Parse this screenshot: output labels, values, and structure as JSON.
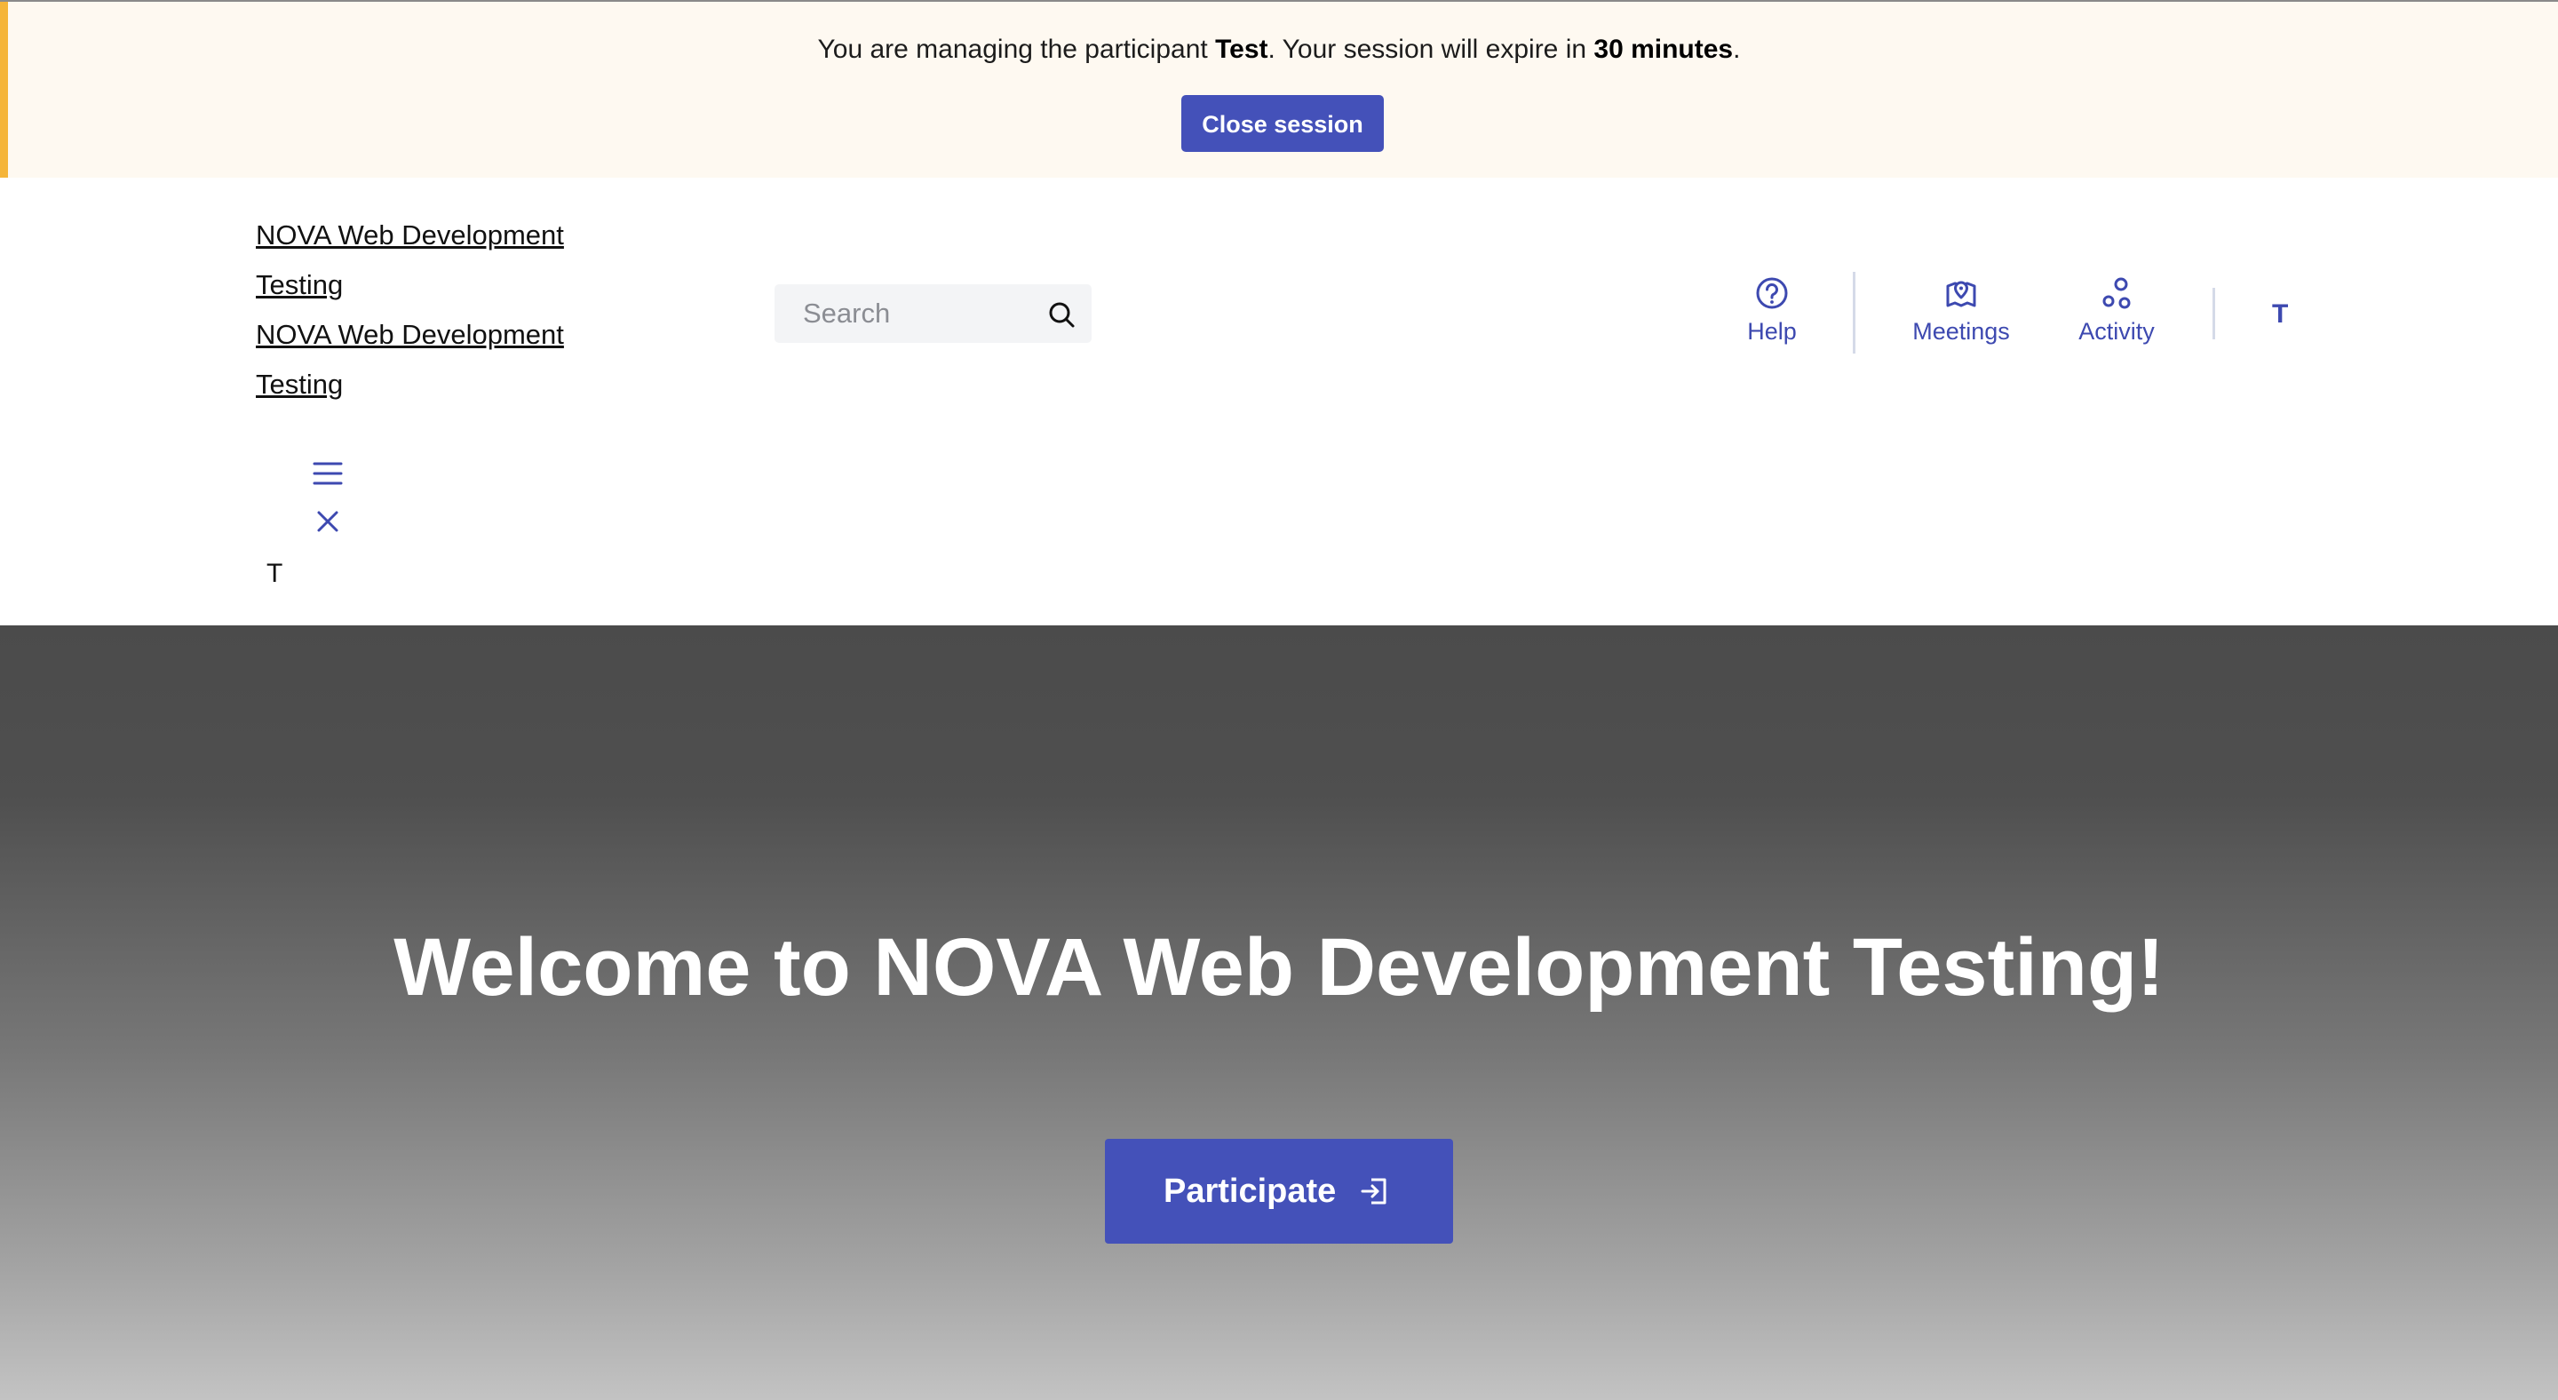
{
  "banner": {
    "text_prefix": "You are managing the participant ",
    "participant": "Test",
    "text_middle": ". Your session will expire in ",
    "duration": "30 minutes",
    "text_suffix": ".",
    "close_button_label": "Close session",
    "accent_color": "#f5b539",
    "background_color": "#fef9f1"
  },
  "header": {
    "org_links": [
      "NOVA Web Development",
      "Testing",
      "NOVA Web Development",
      "Testing"
    ],
    "search": {
      "placeholder": "Search",
      "icon": "search-icon"
    },
    "nav": [
      {
        "label": "Help",
        "icon": "help-icon"
      },
      {
        "label": "Meetings",
        "icon": "meetings-icon"
      },
      {
        "label": "Activity",
        "icon": "activity-icon"
      }
    ],
    "user_initial": "T",
    "mobile": {
      "menu_icon": "menu-icon",
      "close_icon": "close-icon",
      "user_initial": "T"
    },
    "accent_color": "#3d49b0"
  },
  "hero": {
    "title": "Welcome to NOVA Web Development Testing!",
    "participate_label": "Participate",
    "participate_icon": "sign-in-icon",
    "button_color": "#4451b9"
  }
}
